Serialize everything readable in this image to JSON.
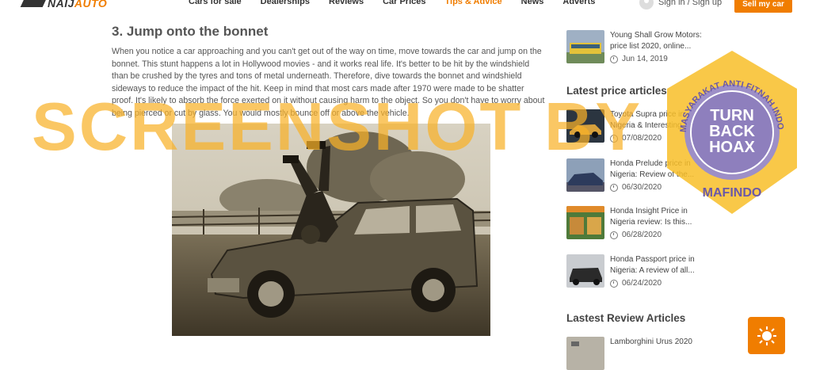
{
  "header": {
    "logo_text_a": "NAIJ",
    "logo_text_b": "AUTO",
    "nav": [
      "Cars for sale",
      "Dealerships",
      "Reviews",
      "Car Prices",
      "Tips & Advice",
      "News",
      "Adverts"
    ],
    "signin_label": "Sign in / Sign up",
    "sell_label": "Sell my car",
    "accent_color": "#f07d00"
  },
  "article": {
    "heading": "3. Jump onto the bonnet",
    "body": "When you notice a car approaching and you can't get out of the way on time, move towards the car and jump on the bonnet. This stunt happens a lot in Hollywood movies - and it works real life. It's better to be hit by the windshield than be crushed by the tyres and tons of metal underneath. Therefore, dive towards the bonnet and windshield sideways to reduce the impact of the hit. Keep in mind that most cars made after 1970 were made to be shatter proof. It's likely to absorb the force exerted on it without causing harm to the object. So you don't have to worry about being pierced or cut by glass. You would mostly bounce off or above the vehicle."
  },
  "sidebar": {
    "top_item": {
      "title": "Young Shall Grow Motors: price list 2020, online...",
      "date": "Jun 14, 2019"
    },
    "latest_heading": "Latest price articles",
    "latest": [
      {
        "title": "Toyota Supra price in Nigeria & Interesting...",
        "date": "07/08/2020"
      },
      {
        "title": "Honda Prelude price in Nigeria: Review of the...",
        "date": "06/30/2020"
      },
      {
        "title": "Honda Insight Price in Nigeria review: Is this...",
        "date": "06/28/2020"
      },
      {
        "title": "Honda Passport price in Nigeria: A review of all...",
        "date": "06/24/2020"
      }
    ],
    "review_heading": "Lastest Review Articles",
    "review_first": "Lamborghini Urus 2020"
  },
  "overlay": {
    "watermark": "SCREENSHOT BY",
    "stamp_ring": "MASYARAKAT ANTI FITNAH INDONESIA",
    "stamp_center": [
      "TURN",
      "BACK",
      "HOAX"
    ],
    "stamp_bottom": "MAFINDO"
  }
}
